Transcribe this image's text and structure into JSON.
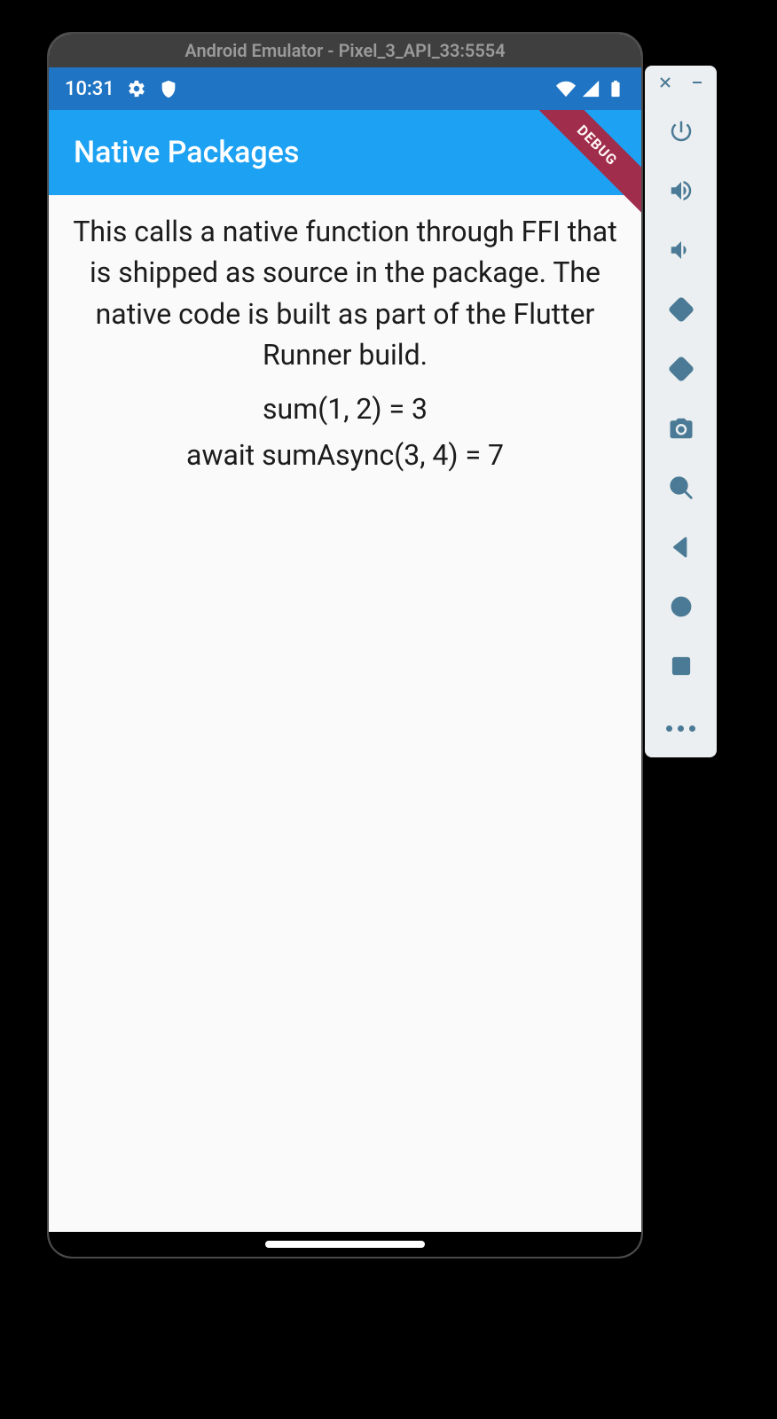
{
  "emulator": {
    "title": "Android Emulator - Pixel_3_API_33:5554"
  },
  "statusBar": {
    "time": "10:31"
  },
  "appBar": {
    "title": "Native Packages"
  },
  "debugRibbon": {
    "label": "DEBUG"
  },
  "content": {
    "description": "This calls a native function through FFI that is shipped as source in the package. The native code is built as part of the Flutter Runner build.",
    "line1": "sum(1, 2) = 3",
    "line2": "await sumAsync(3, 4) = 7"
  },
  "sidebar": {
    "icons": [
      "power",
      "volume-up",
      "volume-down",
      "rotate-left",
      "rotate-right",
      "camera",
      "zoom",
      "back",
      "home",
      "overview",
      "more"
    ]
  }
}
